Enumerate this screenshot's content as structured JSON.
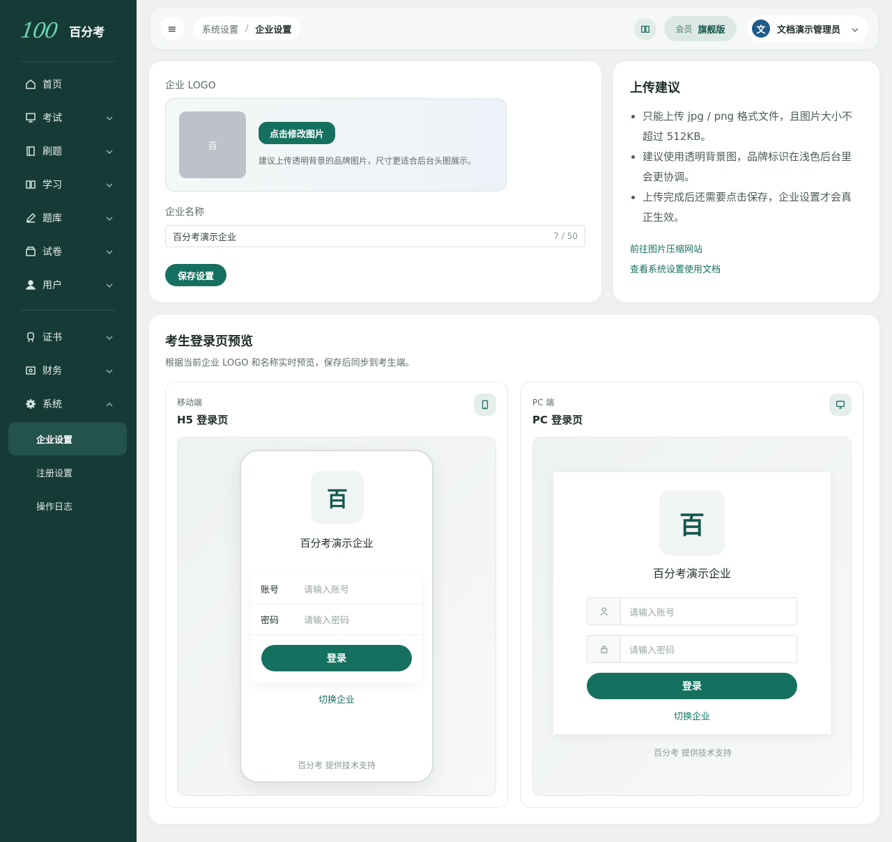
{
  "brand": {
    "logo": "100",
    "name": "百分考"
  },
  "sidebar": {
    "items": [
      {
        "label": "首页",
        "icon": "home-icon"
      },
      {
        "label": "考试",
        "icon": "monitor-icon"
      },
      {
        "label": "刷题",
        "icon": "notebook-icon"
      },
      {
        "label": "学习",
        "icon": "book-open-icon"
      },
      {
        "label": "题库",
        "icon": "pen-icon"
      },
      {
        "label": "试卷",
        "icon": "folder-icon"
      },
      {
        "label": "用户",
        "icon": "user-icon"
      },
      {
        "label": "证书",
        "icon": "certificate-icon"
      },
      {
        "label": "财务",
        "icon": "wallet-icon"
      },
      {
        "label": "系统",
        "icon": "gear-icon"
      }
    ],
    "sub_items": [
      "企业设置",
      "注册设置",
      "操作日志"
    ]
  },
  "header": {
    "menu_icon": "≡",
    "breadcrumb_parent": "系统设置",
    "breadcrumb_sep": "/",
    "breadcrumb_current": "企业设置",
    "member_label": "会员",
    "member_level": "旗舰版",
    "avatar_char": "文",
    "user_name": "文档演示管理员"
  },
  "logo_card": {
    "logo_label": "企业 LOGO",
    "logo_char": "百",
    "change_button": "点击修改图片",
    "logo_hint": "建议上传透明背景的品牌图片，尺寸更适合后台头图展示。",
    "name_label": "企业名称",
    "name_value": "百分考演示企业",
    "name_count": "7 / 50",
    "save_button": "保存设置"
  },
  "tips_card": {
    "title": "上传建议",
    "items": [
      "只能上传 jpg / png 格式文件，且图片大小不超过 512KB。",
      "建议使用透明背景图，品牌标识在浅色后台里会更协调。",
      "上传完成后还需要点击保存，企业设置才会真正生效。"
    ],
    "link_compress": "前往图片压缩网站",
    "link_docs": "查看系统设置使用文档"
  },
  "preview": {
    "title": "考生登录页预览",
    "subtitle": "根据当前企业 LOGO 和名称实时预览，保存后同步到考生端。",
    "mobile": {
      "kicker": "移动端",
      "title": "H5 登录页",
      "logo_char": "百",
      "company": "百分考演示企业",
      "account_label": "账号",
      "account_placeholder": "请输入账号",
      "password_label": "密码",
      "password_placeholder": "请输入密码",
      "login_button": "登录",
      "switch_link": "切换企业",
      "footer": "百分考 提供技术支持"
    },
    "pc": {
      "kicker": "PC 端",
      "title": "PC 登录页",
      "logo_char": "百",
      "company": "百分考演示企业",
      "account_placeholder": "请输入账号",
      "password_placeholder": "请输入密码",
      "login_button": "登录",
      "switch_link": "切换企业",
      "footer": "百分考 提供技术支持"
    }
  },
  "colors": {
    "sidebar_bg": "#163b37",
    "accent": "#15705f",
    "active_item": "#24524c"
  }
}
